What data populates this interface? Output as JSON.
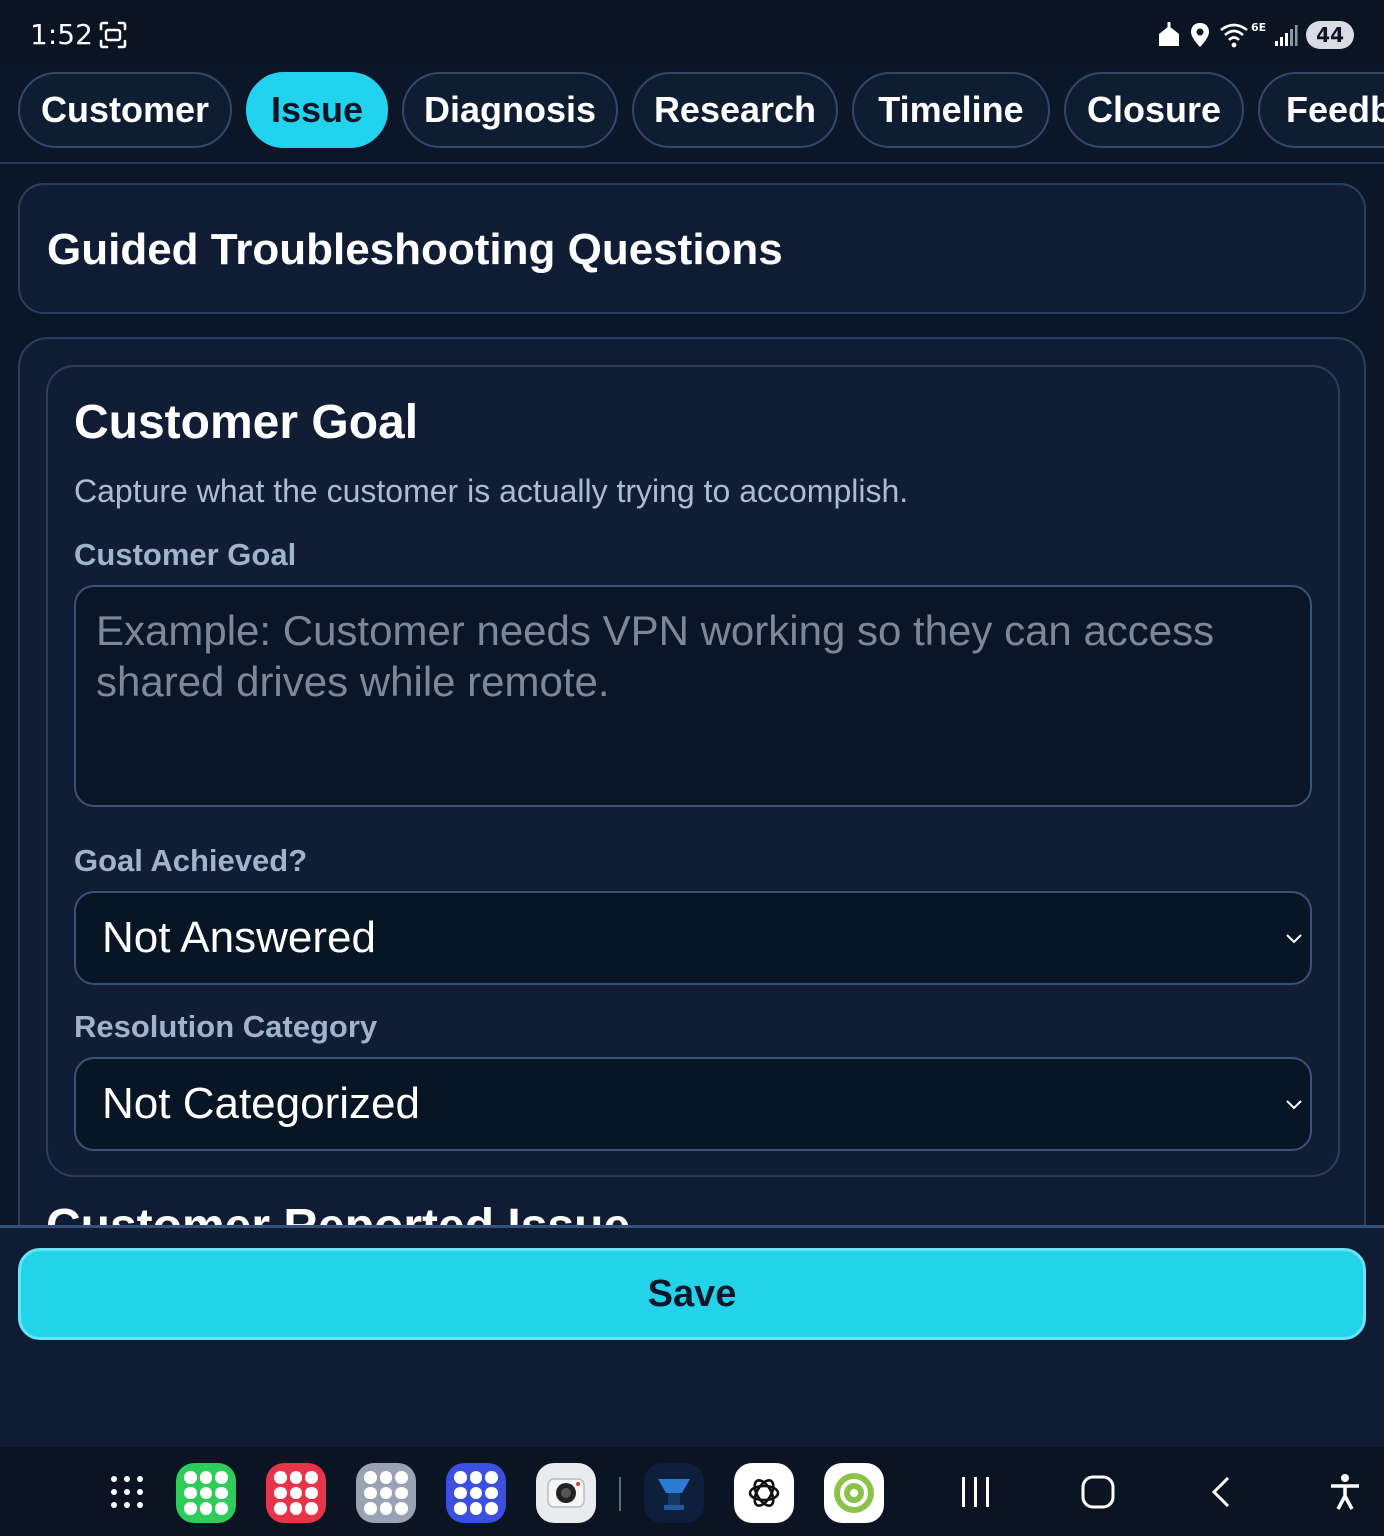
{
  "status_bar": {
    "time": "1:52",
    "network_tag": "6E",
    "battery": "44",
    "icons": [
      "screenshot-icon",
      "home-alert-icon",
      "location-pin-icon",
      "wifi-icon",
      "signal-icon",
      "battery-icon"
    ]
  },
  "tabs": [
    {
      "label": "Customer",
      "active": false
    },
    {
      "label": "Issue",
      "active": true
    },
    {
      "label": "Diagnosis",
      "active": false
    },
    {
      "label": "Research",
      "active": false
    },
    {
      "label": "Timeline",
      "active": false
    },
    {
      "label": "Closure",
      "active": false
    },
    {
      "label": "Feedb",
      "active": false
    }
  ],
  "page": {
    "title": "Guided Troubleshooting Questions"
  },
  "customer_goal_section": {
    "heading": "Customer Goal",
    "description": "Capture what the customer is actually trying to accomplish.",
    "goal_label": "Customer Goal",
    "goal_placeholder": "Example: Customer needs VPN working so they can access shared drives while remote.",
    "goal_achieved_label": "Goal Achieved?",
    "goal_achieved_value": "Not Answered",
    "resolution_label": "Resolution Category",
    "resolution_value": "Not Categorized"
  },
  "next_section": {
    "heading": "Customer Reported Issue"
  },
  "footer": {
    "save_label": "Save"
  },
  "colors": {
    "background": "#0b1729",
    "card": "#0f1c33",
    "accent": "#22d3ee",
    "border": "#2a3f60",
    "label": "#9fb3cc"
  },
  "taskbar": {
    "icons": [
      "app-drawer-icon",
      "app-folder-green-icon",
      "app-folder-red-icon",
      "app-folder-gray-icon",
      "app-folder-blue-icon",
      "camera-icon",
      "tech-app-icon",
      "chatgpt-icon",
      "android-auto-icon",
      "recent-apps-icon",
      "home-icon",
      "back-icon",
      "accessibility-icon"
    ]
  }
}
